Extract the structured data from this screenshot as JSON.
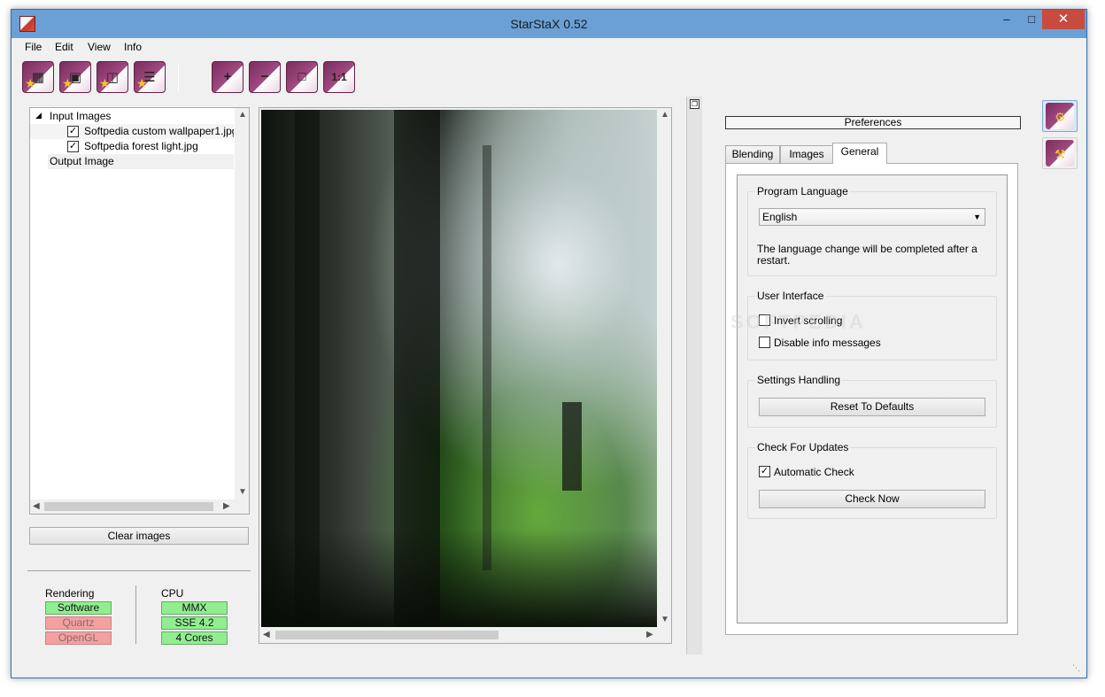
{
  "window": {
    "title": "StarStaX 0.52",
    "min_label": "–",
    "max_label": "□",
    "close_label": "✕"
  },
  "menu": {
    "file": "File",
    "edit": "Edit",
    "view": "View",
    "info": "Info"
  },
  "toolbar": {
    "open_icon": "open-images-icon",
    "dark_icon": "open-dark-frames-icon",
    "save_icon": "save-icon",
    "stack_icon": "start-processing-icon",
    "zoom_in_glyph": "+",
    "zoom_out_glyph": "−",
    "fit_glyph": "□",
    "actual_glyph": "1:1"
  },
  "tree": {
    "input_images": "Input Images",
    "files": [
      {
        "name": "Softpedia custom wallpaper1.jpg",
        "checked": true
      },
      {
        "name": "Softpedia forest light.jpg",
        "checked": true
      }
    ],
    "output_image": "Output Image"
  },
  "clear_images": "Clear images",
  "rendering": {
    "title": "Rendering",
    "software": "Software",
    "quartz": "Quartz",
    "opengl": "OpenGL"
  },
  "cpu": {
    "title": "CPU",
    "mmx": "MMX",
    "sse": "SSE 4.2",
    "cores": "4 Cores"
  },
  "prefs": {
    "header": "Preferences",
    "tabs": [
      "Blending",
      "Images",
      "General"
    ],
    "active_tab": "General",
    "program_language": {
      "title": "Program Language",
      "selected": "English",
      "note": "The language change will be completed after a restart."
    },
    "user_interface": {
      "title": "User Interface",
      "invert_scrolling": "Invert scrolling",
      "disable_info": "Disable info messages"
    },
    "settings_handling": {
      "title": "Settings Handling",
      "reset": "Reset To Defaults"
    },
    "updates": {
      "title": "Check For Updates",
      "automatic": "Automatic Check",
      "check_now": "Check Now"
    }
  },
  "watermark": "SOFTPEDIA",
  "colors": {
    "active_badge": "#90ee90",
    "inactive_badge": "#f4a0a0",
    "titlebar": "#6aa0d6",
    "close": "#c74b3f"
  }
}
